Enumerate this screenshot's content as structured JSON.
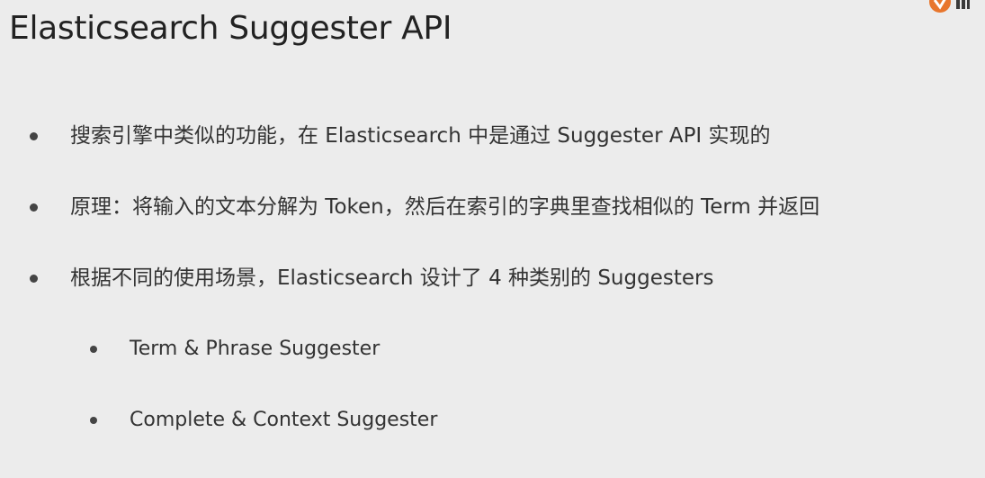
{
  "slide": {
    "title": "Elasticsearch Suggester API",
    "bullets": [
      {
        "text": "搜索引擎中类似的功能，在 Elasticsearch 中是通过 Suggester API 实现的"
      },
      {
        "text": "原理：将输入的文本分解为 Token，然后在索引的字典里查找相似的 Term 并返回"
      },
      {
        "text": "根据不同的使用场景，Elasticsearch 设计了 4 种类别的 Suggesters"
      }
    ],
    "sub_bullets": [
      {
        "text": "Term & Phrase Suggester"
      },
      {
        "text": "Complete & Context Suggester"
      }
    ]
  },
  "logo": {
    "icon": "brand-logo-icon",
    "color": "#e8762d"
  },
  "colors": {
    "background": "#ececec",
    "text": "#333333",
    "bullet": "#444444"
  }
}
